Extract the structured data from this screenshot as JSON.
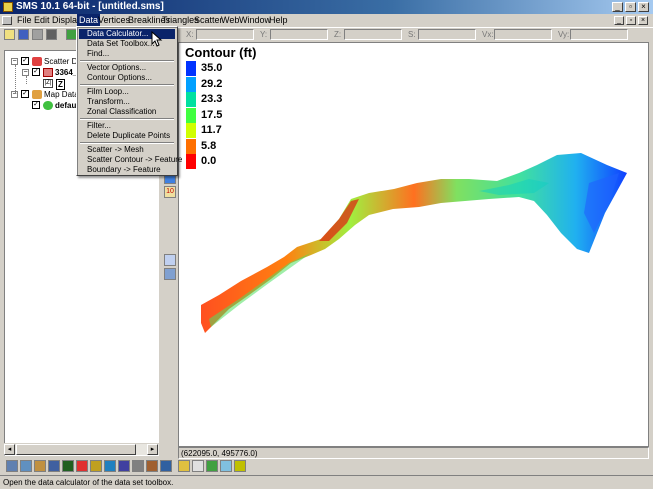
{
  "window": {
    "title": "SMS 10.1 64-bit - [untitled.sms]"
  },
  "menubar": {
    "items": [
      "File",
      "Edit",
      "Display",
      "Data",
      "Vertices",
      "Breaklines",
      "Triangles",
      "Scatter",
      "Web",
      "Window",
      "Help"
    ],
    "active": "Data"
  },
  "toolbar": {
    "coord_labels": [
      "X:",
      "Y:",
      "Z:",
      "S:",
      "Vx:",
      "Vy:"
    ]
  },
  "data_menu": {
    "items": [
      {
        "label": "Data Calculator...",
        "highlighted": true
      },
      {
        "label": "Data Set Toolbox..."
      },
      {
        "label": "Find..."
      },
      {
        "separator": true
      },
      {
        "label": "Vector Options..."
      },
      {
        "label": "Contour Options..."
      },
      {
        "separator": true
      },
      {
        "label": "Film Loop..."
      },
      {
        "label": "Transform..."
      },
      {
        "label": "Zonal Classification"
      },
      {
        "separator": true
      },
      {
        "label": "Filter..."
      },
      {
        "label": "Delete Duplicate Points"
      },
      {
        "separator": true
      },
      {
        "label": "Scatter -> Mesh"
      },
      {
        "label": "Scatter Contour -> Feature"
      },
      {
        "label": "Boundary -> Feature"
      }
    ]
  },
  "tree": {
    "items": [
      {
        "label": "Scatter Data",
        "level": 0,
        "expander": "-",
        "icon": "scatter-data-icon"
      },
      {
        "label": "3364_C",
        "level": 1,
        "expander": "-",
        "icon": "scatter-set-icon",
        "bold": true
      },
      {
        "label": "Z",
        "level": 2,
        "icon": "dataset-icon"
      },
      {
        "label": "Map Data",
        "level": 0,
        "expander": "-",
        "icon": "map-data-icon"
      },
      {
        "label": "default",
        "level": 1,
        "icon": "coverage-icon",
        "bold": true
      }
    ]
  },
  "legend": {
    "title": "Contour (ft)",
    "entries": [
      {
        "label": "35.0",
        "color": "#0033ff"
      },
      {
        "label": "29.2",
        "color": "#00a0ff"
      },
      {
        "label": "23.3",
        "color": "#00e0a0"
      },
      {
        "label": "17.5",
        "color": "#40ff40"
      },
      {
        "label": "11.7",
        "color": "#d0ff00"
      },
      {
        "label": "5.8",
        "color": "#ff7000"
      },
      {
        "label": "0.0",
        "color": "#ff0000"
      }
    ]
  },
  "status": {
    "coordinates": "(622095.0, 495776.0)",
    "message": "Open the data calculator of the data set toolbox."
  },
  "colors": {
    "title_bar": "#0a246a",
    "window_bg": "#d4d0c8",
    "highlight": "#0a246a"
  }
}
